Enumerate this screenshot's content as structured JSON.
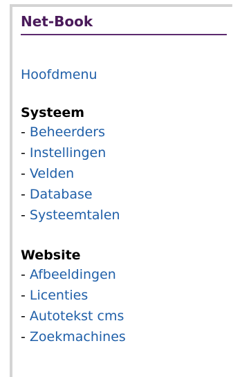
{
  "brand": {
    "title": "Net-Book"
  },
  "nav": {
    "home_label": "Hoofdmenu",
    "sections": [
      {
        "title": "Systeem",
        "items": [
          "Beheerders",
          "Instellingen",
          "Velden",
          "Database",
          "Systeemtalen"
        ]
      },
      {
        "title": "Website",
        "items": [
          "Afbeeldingen",
          "Licenties",
          "Autotekst cms",
          "Zoekmachines"
        ]
      }
    ]
  },
  "colors": {
    "title": "#4a1a5a",
    "link": "#1f5fa8",
    "frame_border": "#d4d4d4"
  }
}
